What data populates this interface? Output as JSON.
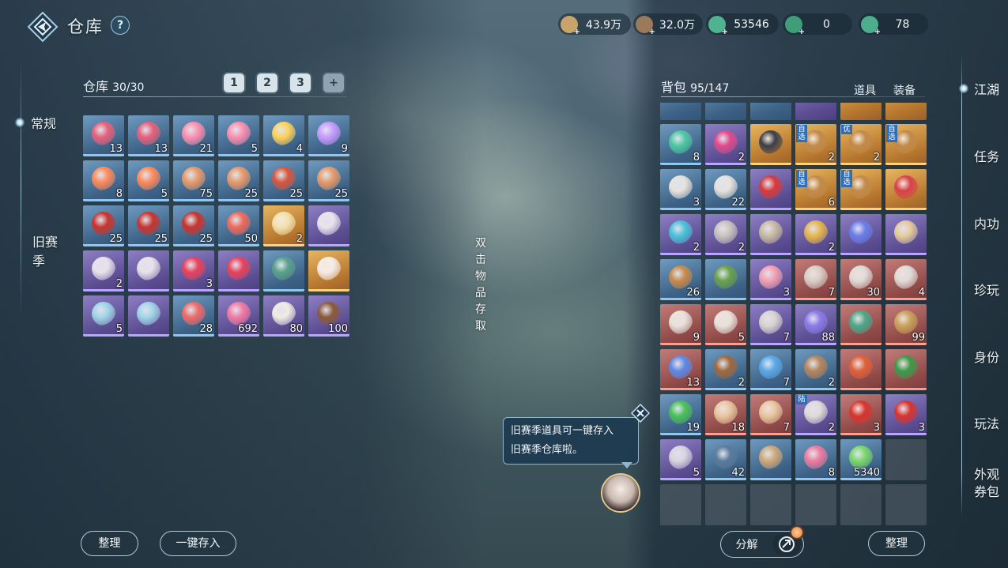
{
  "header": {
    "title": "仓库",
    "help": "?"
  },
  "currencies": [
    {
      "icon": "silver-bundle-icon",
      "value": "43.9万",
      "color": "#c8a46a"
    },
    {
      "icon": "copper-coin-icon",
      "value": "32.0万",
      "color": "#9a7a5a"
    },
    {
      "icon": "jade-bead-icon",
      "value": "53546",
      "color": "#4fb390"
    },
    {
      "icon": "jade-token-icon",
      "value": "0",
      "color": "#3f9e78"
    },
    {
      "icon": "jade-ring-icon",
      "value": "78",
      "color": "#4cae8c"
    }
  ],
  "left_nav": {
    "active": "常规",
    "items": [
      "旧赛",
      "季"
    ]
  },
  "warehouse": {
    "label": "仓库",
    "count": "30/30",
    "page_tabs": [
      "1",
      "2",
      "3",
      "+"
    ],
    "slots": [
      {
        "q": "blue",
        "icon": "heart-charm-icon",
        "c": "#e8607a",
        "n": "13"
      },
      {
        "q": "blue",
        "icon": "heart-charm-icon",
        "c": "#e8607a",
        "n": "13"
      },
      {
        "q": "blue",
        "icon": "hearts-icon",
        "c": "#ff8fb0",
        "n": "21"
      },
      {
        "q": "blue",
        "icon": "hearts-icon",
        "c": "#ff8fb0",
        "n": "5"
      },
      {
        "q": "blue",
        "icon": "sky-lantern-icon",
        "c": "#ffd35a",
        "n": "4"
      },
      {
        "q": "blue",
        "icon": "sky-lantern-icon",
        "c": "#c89bff",
        "n": "9"
      },
      {
        "q": "blue",
        "icon": "lantern-icon",
        "c": "#ff8a5a",
        "n": "8"
      },
      {
        "q": "blue",
        "icon": "lantern-icon",
        "c": "#ff8a5a",
        "n": "5"
      },
      {
        "q": "blue",
        "icon": "firecracker-icon",
        "c": "#e89a6a",
        "n": "75"
      },
      {
        "q": "blue",
        "icon": "firecracker-icon",
        "c": "#e89a6a",
        "n": "25"
      },
      {
        "q": "blue",
        "icon": "firecracker-icon",
        "c": "#d9553e",
        "n": "25"
      },
      {
        "q": "blue",
        "icon": "firecracker-icon",
        "c": "#e89a6a",
        "n": "25"
      },
      {
        "q": "blue",
        "icon": "firecracker-icon",
        "c": "#c8342e",
        "n": "25"
      },
      {
        "q": "blue",
        "icon": "firecracker-icon",
        "c": "#c8342e",
        "n": "25"
      },
      {
        "q": "blue",
        "icon": "firecracker-icon",
        "c": "#c8342e",
        "n": "25"
      },
      {
        "q": "blue",
        "icon": "cat-charm-icon",
        "c": "#ef6a5a",
        "n": "50"
      },
      {
        "q": "gold",
        "icon": "portrait-card-icon",
        "c": "#f2e2b0",
        "n": "2"
      },
      {
        "q": "purple",
        "icon": "incense-burner-icon",
        "c": "#e8e4ec",
        "n": ""
      },
      {
        "q": "purple",
        "icon": "costume-figure-icon",
        "c": "#e6e2ea",
        "n": "2"
      },
      {
        "q": "purple",
        "icon": "costume-figure-icon",
        "c": "#e6e2ea",
        "n": ""
      },
      {
        "q": "purple",
        "icon": "red-knot-icon",
        "c": "#e8425a",
        "n": "3"
      },
      {
        "q": "purple",
        "icon": "red-knot-icon",
        "c": "#e8425a",
        "n": ""
      },
      {
        "q": "blue",
        "icon": "dragon-boat-icon",
        "c": "#5aa08a",
        "n": ""
      },
      {
        "q": "gold",
        "icon": "character-portrait-icon",
        "c": "#f4ecea",
        "n": ""
      },
      {
        "q": "purple",
        "icon": "ghost-spirit-icon",
        "c": "#9fd6e6",
        "n": "5"
      },
      {
        "q": "purple",
        "icon": "ghost-spirit-icon",
        "c": "#9fd6e6",
        "n": ""
      },
      {
        "q": "blue",
        "icon": "red-ticket-icon",
        "c": "#ef6a6a",
        "n": "28"
      },
      {
        "q": "purple",
        "icon": "pink-orb-icon",
        "c": "#f17aa2",
        "n": "692"
      },
      {
        "q": "purple",
        "icon": "lion-mask-icon",
        "c": "#f0ece2",
        "n": "80"
      },
      {
        "q": "purple",
        "icon": "treasure-chest-icon",
        "c": "#8a5a3a",
        "n": "100"
      }
    ]
  },
  "double_click_hint": [
    "双",
    "击",
    "物",
    "品",
    "存",
    "取"
  ],
  "bag": {
    "label": "背包",
    "count": "95/147",
    "tabs": [
      "道具",
      "装备"
    ],
    "slots": [
      {
        "q": "blue",
        "icon": "jade-ball-icon",
        "c": "#4fc7a0",
        "n": "8"
      },
      {
        "q": "purple",
        "icon": "upgrade-orb-icon",
        "c": "#e04a8a",
        "n": "2"
      },
      {
        "q": "gold",
        "icon": "ink-box-icon",
        "c": "#3a3e4a",
        "n": ""
      },
      {
        "q": "gold",
        "icon": "select-chest-icon",
        "c": "#c28a4a",
        "n": "2",
        "tag": "自选"
      },
      {
        "q": "gold",
        "icon": "select-chest-icon",
        "c": "#c28a4a",
        "n": "2",
        "tag": "优"
      },
      {
        "q": "gold",
        "icon": "select-chest-icon",
        "c": "#c28a4a",
        "n": "",
        "tag": "自选"
      },
      {
        "q": "blue",
        "icon": "gourd-icon",
        "c": "#e8e2dc",
        "n": "3"
      },
      {
        "q": "blue",
        "icon": "gourd-icon",
        "c": "#e8e2dc",
        "n": "22"
      },
      {
        "q": "purple",
        "icon": "gift-box-icon",
        "c": "#d83a3a",
        "n": ""
      },
      {
        "q": "gold",
        "icon": "select-chest-icon",
        "c": "#c28a4a",
        "n": "6",
        "tag": "自选"
      },
      {
        "q": "gold",
        "icon": "select-chest-icon",
        "c": "#c28a4a",
        "n": "",
        "tag": "自选"
      },
      {
        "q": "gold",
        "icon": "pomegranate-icon",
        "c": "#d8404a",
        "n": ""
      },
      {
        "q": "purple",
        "icon": "crystal-icon",
        "c": "#4ac2d8",
        "n": "2"
      },
      {
        "q": "purple",
        "icon": "stone-shard-icon",
        "c": "#c8c4bc",
        "n": "2"
      },
      {
        "q": "purple",
        "icon": "map-scroll-icon",
        "c": "#c8bba0",
        "n": ""
      },
      {
        "q": "purple",
        "icon": "gold-coin-icon",
        "c": "#e6b84a",
        "n": "2"
      },
      {
        "q": "purple",
        "icon": "blue-ticket-icon",
        "c": "#6a7ee8",
        "n": ""
      },
      {
        "q": "purple",
        "icon": "edict-scroll-icon",
        "c": "#e6cc9a",
        "n": ""
      },
      {
        "q": "blue",
        "icon": "firewood-icon",
        "c": "#c88a4a",
        "n": "26"
      },
      {
        "q": "blue",
        "icon": "rice-dumpling-icon",
        "c": "#6aa04a",
        "n": ""
      },
      {
        "q": "purple",
        "icon": "crystal-ball-icon",
        "c": "#f4a0b0",
        "n": "3"
      },
      {
        "q": "red",
        "icon": "ornate-jar-icon",
        "c": "#d8d0c8",
        "n": "7"
      },
      {
        "q": "red",
        "icon": "porcelain-vase-icon",
        "c": "#e0dcd8",
        "n": "30"
      },
      {
        "q": "red",
        "icon": "porcelain-vase-icon",
        "c": "#e0dcd8",
        "n": "4"
      },
      {
        "q": "red",
        "icon": "gourd-icon",
        "c": "#e8e2dc",
        "n": "9"
      },
      {
        "q": "red",
        "icon": "gourd-icon",
        "c": "#e8e2dc",
        "n": "5"
      },
      {
        "q": "purple",
        "icon": "fish-ornament-icon",
        "c": "#d8d4d0",
        "n": "7"
      },
      {
        "q": "purple",
        "icon": "purple-disc-icon",
        "c": "#8a7ae8",
        "n": "88"
      },
      {
        "q": "red",
        "icon": "pouch-icon",
        "c": "#4aa88a",
        "n": ""
      },
      {
        "q": "red",
        "icon": "flute-icon",
        "c": "#c8a25a",
        "n": "99"
      },
      {
        "q": "red",
        "icon": "blue-talisman-icon",
        "c": "#5a8ae8",
        "n": "13"
      },
      {
        "q": "blue",
        "icon": "bamboo-slips-icon",
        "c": "#a0683a",
        "n": "2"
      },
      {
        "q": "blue",
        "icon": "blue-pass-icon",
        "c": "#5aa8e8",
        "n": "7"
      },
      {
        "q": "blue",
        "icon": "brown-pass-icon",
        "c": "#b8845a",
        "n": "2"
      },
      {
        "q": "red",
        "icon": "red-pass-icon",
        "c": "#e0603a",
        "n": ""
      },
      {
        "q": "red",
        "icon": "holly-icon",
        "c": "#3a9a4a",
        "n": ""
      },
      {
        "q": "blue",
        "icon": "jade-flute-icon",
        "c": "#4ac05a",
        "n": "19"
      },
      {
        "q": "red",
        "icon": "dumpling-bowl-icon",
        "c": "#e8c8a0",
        "n": "18"
      },
      {
        "q": "red",
        "icon": "dumpling-bowl-icon",
        "c": "#e8c8a0",
        "n": "7"
      },
      {
        "q": "purple",
        "icon": "spirit-figure-icon",
        "c": "#e0dcd8",
        "n": "2",
        "tag": "陆"
      },
      {
        "q": "red",
        "icon": "red-banner-icon",
        "c": "#d8342e",
        "n": "3"
      },
      {
        "q": "purple",
        "icon": "red-banner-icon",
        "c": "#d8342e",
        "n": "3"
      },
      {
        "q": "purple",
        "icon": "silver-ingot-icon",
        "c": "#d8d4e0",
        "n": "5"
      },
      {
        "q": "blue",
        "icon": "crossed-swords-icon",
        "c": "#5a7a9a",
        "n": "42"
      },
      {
        "q": "blue",
        "icon": "brown-ticket-icon",
        "c": "#d0a878",
        "n": ""
      },
      {
        "q": "blue",
        "icon": "pink-talisman-icon",
        "c": "#f07aa0",
        "n": "8"
      },
      {
        "q": "blue",
        "icon": "green-dragon-icon",
        "c": "#7ad86a",
        "n": "5340"
      },
      {
        "q": "empty",
        "icon": "",
        "c": "",
        "n": ""
      },
      {
        "q": "empty",
        "icon": "",
        "c": "",
        "n": ""
      },
      {
        "q": "empty",
        "icon": "",
        "c": "",
        "n": ""
      },
      {
        "q": "empty",
        "icon": "",
        "c": "",
        "n": ""
      },
      {
        "q": "empty",
        "icon": "",
        "c": "",
        "n": ""
      },
      {
        "q": "empty",
        "icon": "",
        "c": "",
        "n": ""
      },
      {
        "q": "empty",
        "icon": "",
        "c": "",
        "n": ""
      }
    ]
  },
  "tooltip": {
    "line1": "旧赛季道具可一键存入",
    "line2": "旧赛季仓库啦。"
  },
  "buttons": {
    "sort_left": "整理",
    "deposit_all": "一键存入",
    "decompose": "分解",
    "sort_right": "整理"
  },
  "right_nav": {
    "active": "江湖",
    "items": [
      "任务",
      "内功",
      "珍玩",
      "身份",
      "玩法",
      "外观",
      "券包"
    ]
  }
}
